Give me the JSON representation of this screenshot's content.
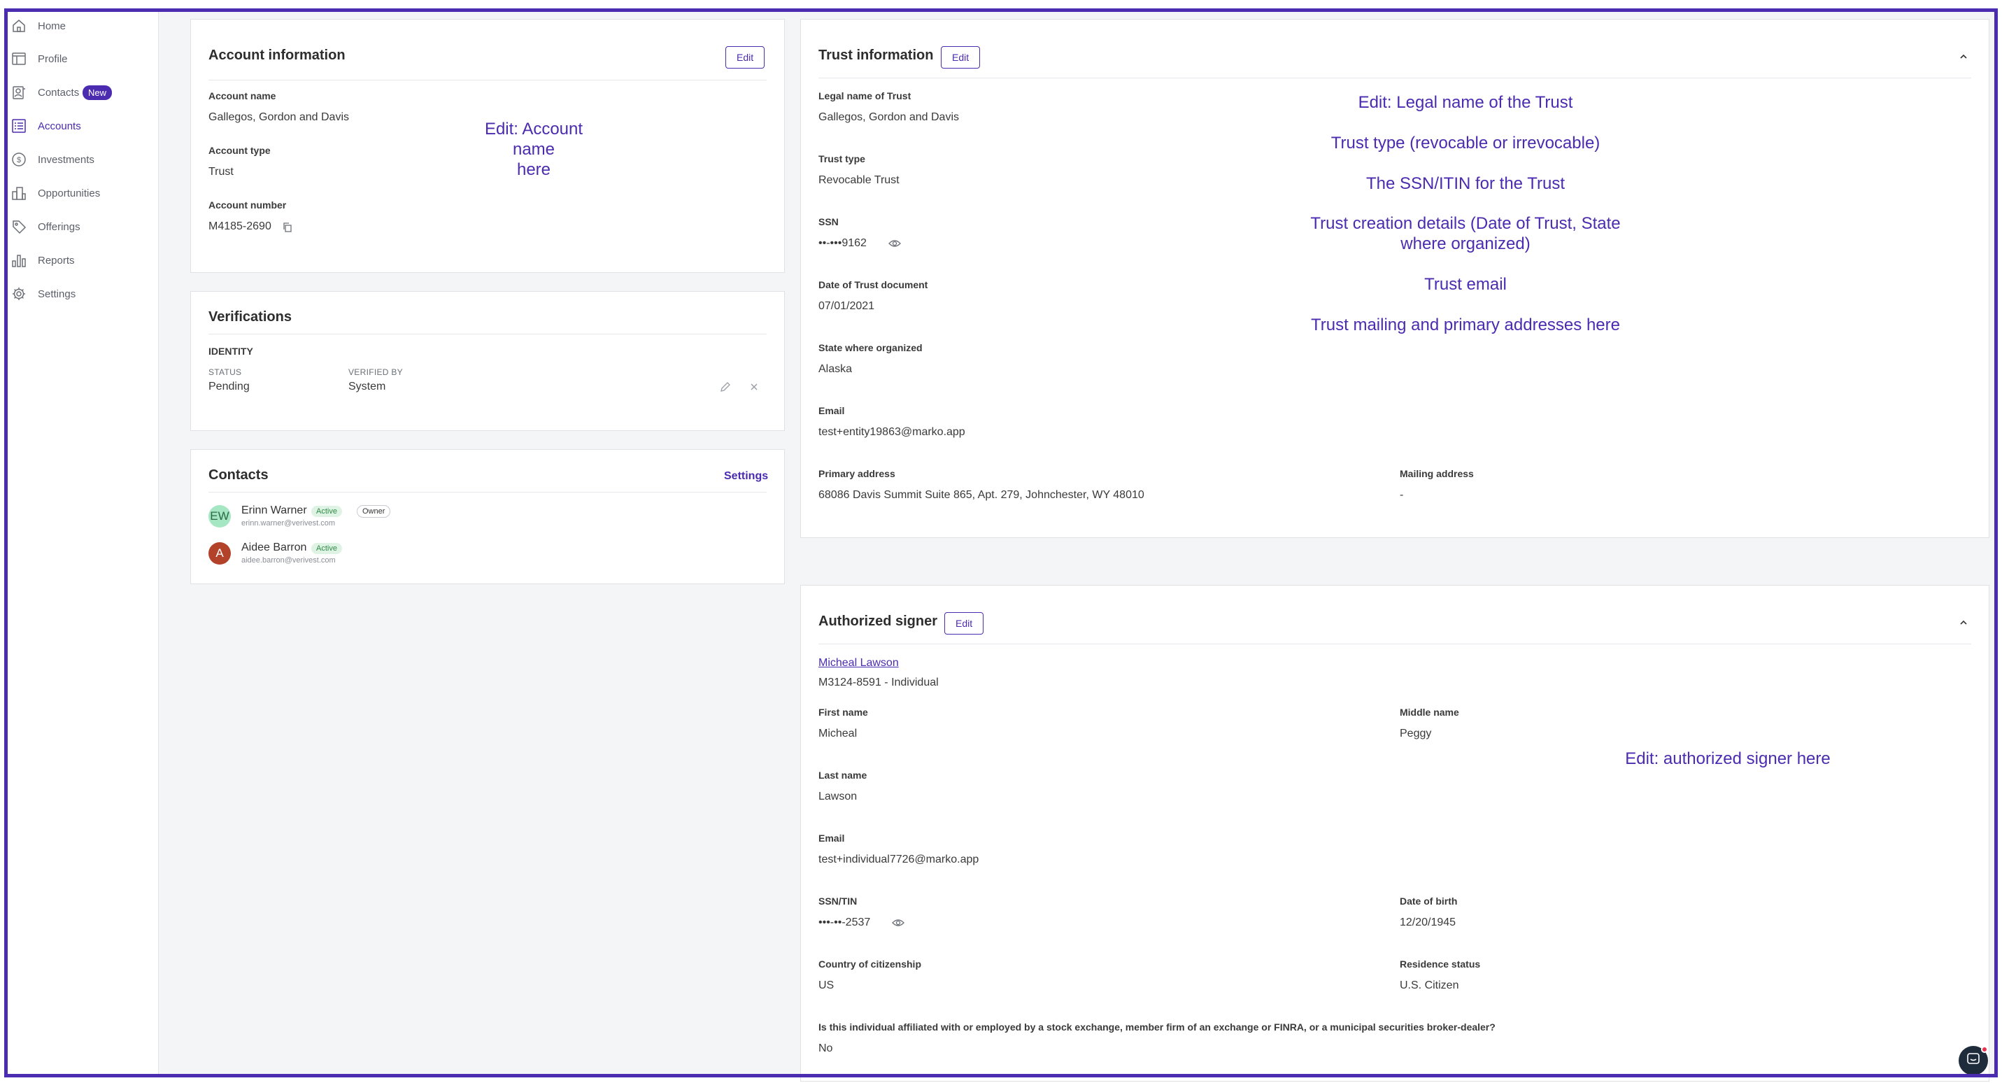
{
  "sidebar": {
    "items": [
      {
        "label": "Home",
        "icon": "home-icon"
      },
      {
        "label": "Profile",
        "icon": "profile-icon"
      },
      {
        "label": "Contacts",
        "icon": "contacts-icon",
        "badge": "New"
      },
      {
        "label": "Accounts",
        "icon": "accounts-icon",
        "active": true
      },
      {
        "label": "Investments",
        "icon": "investments-icon"
      },
      {
        "label": "Opportunities",
        "icon": "opportunities-icon"
      },
      {
        "label": "Offerings",
        "icon": "offerings-icon"
      },
      {
        "label": "Reports",
        "icon": "reports-icon"
      },
      {
        "label": "Settings",
        "icon": "settings-icon"
      }
    ]
  },
  "account_info": {
    "title": "Account information",
    "edit_label": "Edit",
    "name_label": "Account name",
    "name_value": "Gallegos, Gordon and Davis",
    "type_label": "Account type",
    "type_value": "Trust",
    "number_label": "Account number",
    "number_value": "M4185-2690",
    "annotation": "Edit: Account\nname\nhere"
  },
  "verifications": {
    "title": "Verifications",
    "section": "IDENTITY",
    "status_label": "STATUS",
    "status_value": "Pending",
    "verified_by_label": "VERIFIED BY",
    "verified_by_value": "System"
  },
  "contacts": {
    "title": "Contacts",
    "settings_label": "Settings",
    "items": [
      {
        "initials": "EW",
        "name": "Erinn Warner",
        "email": "erinn.warner@verivest.com",
        "status": "Active",
        "role": "Owner"
      },
      {
        "initials": "A",
        "name": "Aidee Barron",
        "email": "aidee.barron@verivest.com",
        "status": "Active"
      }
    ]
  },
  "trust_info": {
    "title": "Trust information",
    "edit_label": "Edit",
    "legal_name_label": "Legal name of Trust",
    "legal_name_value": "Gallegos, Gordon and Davis",
    "type_label": "Trust type",
    "type_value": "Revocable Trust",
    "ssn_label": "SSN",
    "ssn_value": "••-•••9162",
    "date_label": "Date of Trust document",
    "date_value": "07/01/2021",
    "state_label": "State where organized",
    "state_value": "Alaska",
    "email_label": "Email",
    "email_value": "test+entity19863@marko.app",
    "primary_label": "Primary address",
    "primary_value": "68086 Davis Summit Suite 865, Apt. 279, Johnchester, WY 48010",
    "mailing_label": "Mailing address",
    "mailing_value": "-",
    "annotations": [
      "Edit: Legal name of the Trust",
      "Trust type (revocable or irrevocable)",
      "The SSN/ITIN for the Trust",
      "Trust creation details (Date of Trust, State\nwhere organized)",
      "Trust email",
      "Trust mailing and primary addresses here"
    ]
  },
  "signer": {
    "title": "Authorized signer",
    "edit_label": "Edit",
    "name_link": "Micheal Lawson",
    "subline": "M3124-8591 - Individual",
    "first_label": "First name",
    "first_value": "Micheal",
    "middle_label": "Middle name",
    "middle_value": "Peggy",
    "last_label": "Last name",
    "last_value": "Lawson",
    "email_label": "Email",
    "email_value": "test+individual7726@marko.app",
    "ssn_label": "SSN/TIN",
    "ssn_value": "•••-••-2537",
    "dob_label": "Date of birth",
    "dob_value": "12/20/1945",
    "country_label": "Country of citizenship",
    "country_value": "US",
    "residence_label": "Residence status",
    "residence_value": "U.S. Citizen",
    "affiliated_label": "Is this individual affiliated with or employed by a stock exchange, member firm of an exchange or FINRA, or a municipal securities broker-dealer?",
    "affiliated_value": "No",
    "annotation": "Edit: authorized signer here"
  },
  "colors": {
    "accent": "#4b2bb0",
    "active_green": "#2f8a47",
    "background": "#f4f5f7"
  }
}
